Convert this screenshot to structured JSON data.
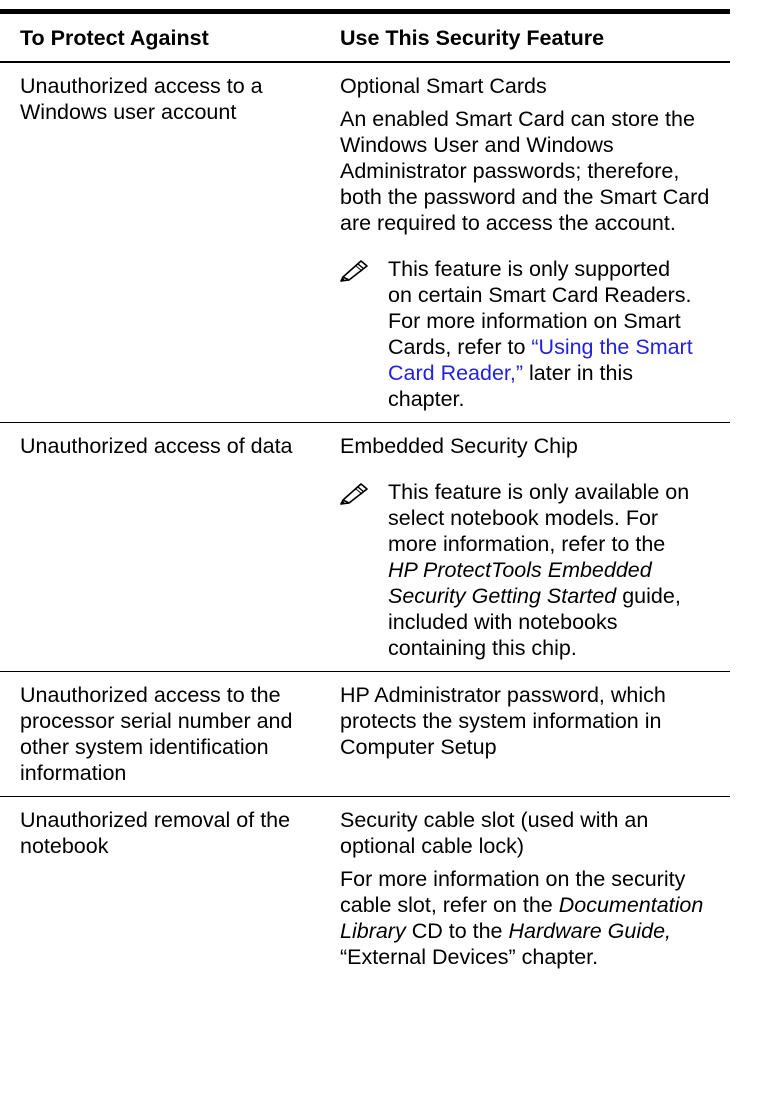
{
  "table": {
    "header": {
      "col1": "To Protect Against",
      "col2": "Use This Security Feature"
    },
    "rows": [
      {
        "threat": "Unauthorized access to a Windows user account",
        "feature": "Optional Smart Cards",
        "detail": "An enabled Smart Card can store the Windows User and Windows Administrator passwords; therefore, both the password and the Smart Card are required to access the account.",
        "note": {
          "icon": "note-pencil-icon",
          "text_before": "This feature is only supported on certain Smart Card Readers. For more information on Smart Cards, refer to ",
          "link_text": "“Using the Smart Card Reader,”",
          "text_after": " later in this chapter."
        }
      },
      {
        "threat": "Unauthorized access of data",
        "feature": "Embedded Security Chip",
        "note": {
          "icon": "note-pencil-icon",
          "text_before": "This feature is only available on select notebook models. For more information, refer to the ",
          "italic": "HP ProtectTools Embedded Security Getting Started",
          "text_after": " guide, included with notebooks containing this chip."
        }
      },
      {
        "threat": "Unauthorized access to the processor serial number and other system identification information",
        "feature": "HP Administrator password, which protects the system information in Computer Setup"
      },
      {
        "threat": "Unauthorized removal of the notebook",
        "feature": "Security cable slot (used with an optional cable lock)",
        "detail": {
          "text1": "For more information on the security cable slot, refer on the ",
          "italic1": "Documentation Library",
          "text2": " CD to the ",
          "italic2": "Hardware Guide,",
          "text3": " “External Devices” chapter."
        }
      }
    ]
  },
  "colors": {
    "link": "#2222dd",
    "rule": "#000000"
  }
}
